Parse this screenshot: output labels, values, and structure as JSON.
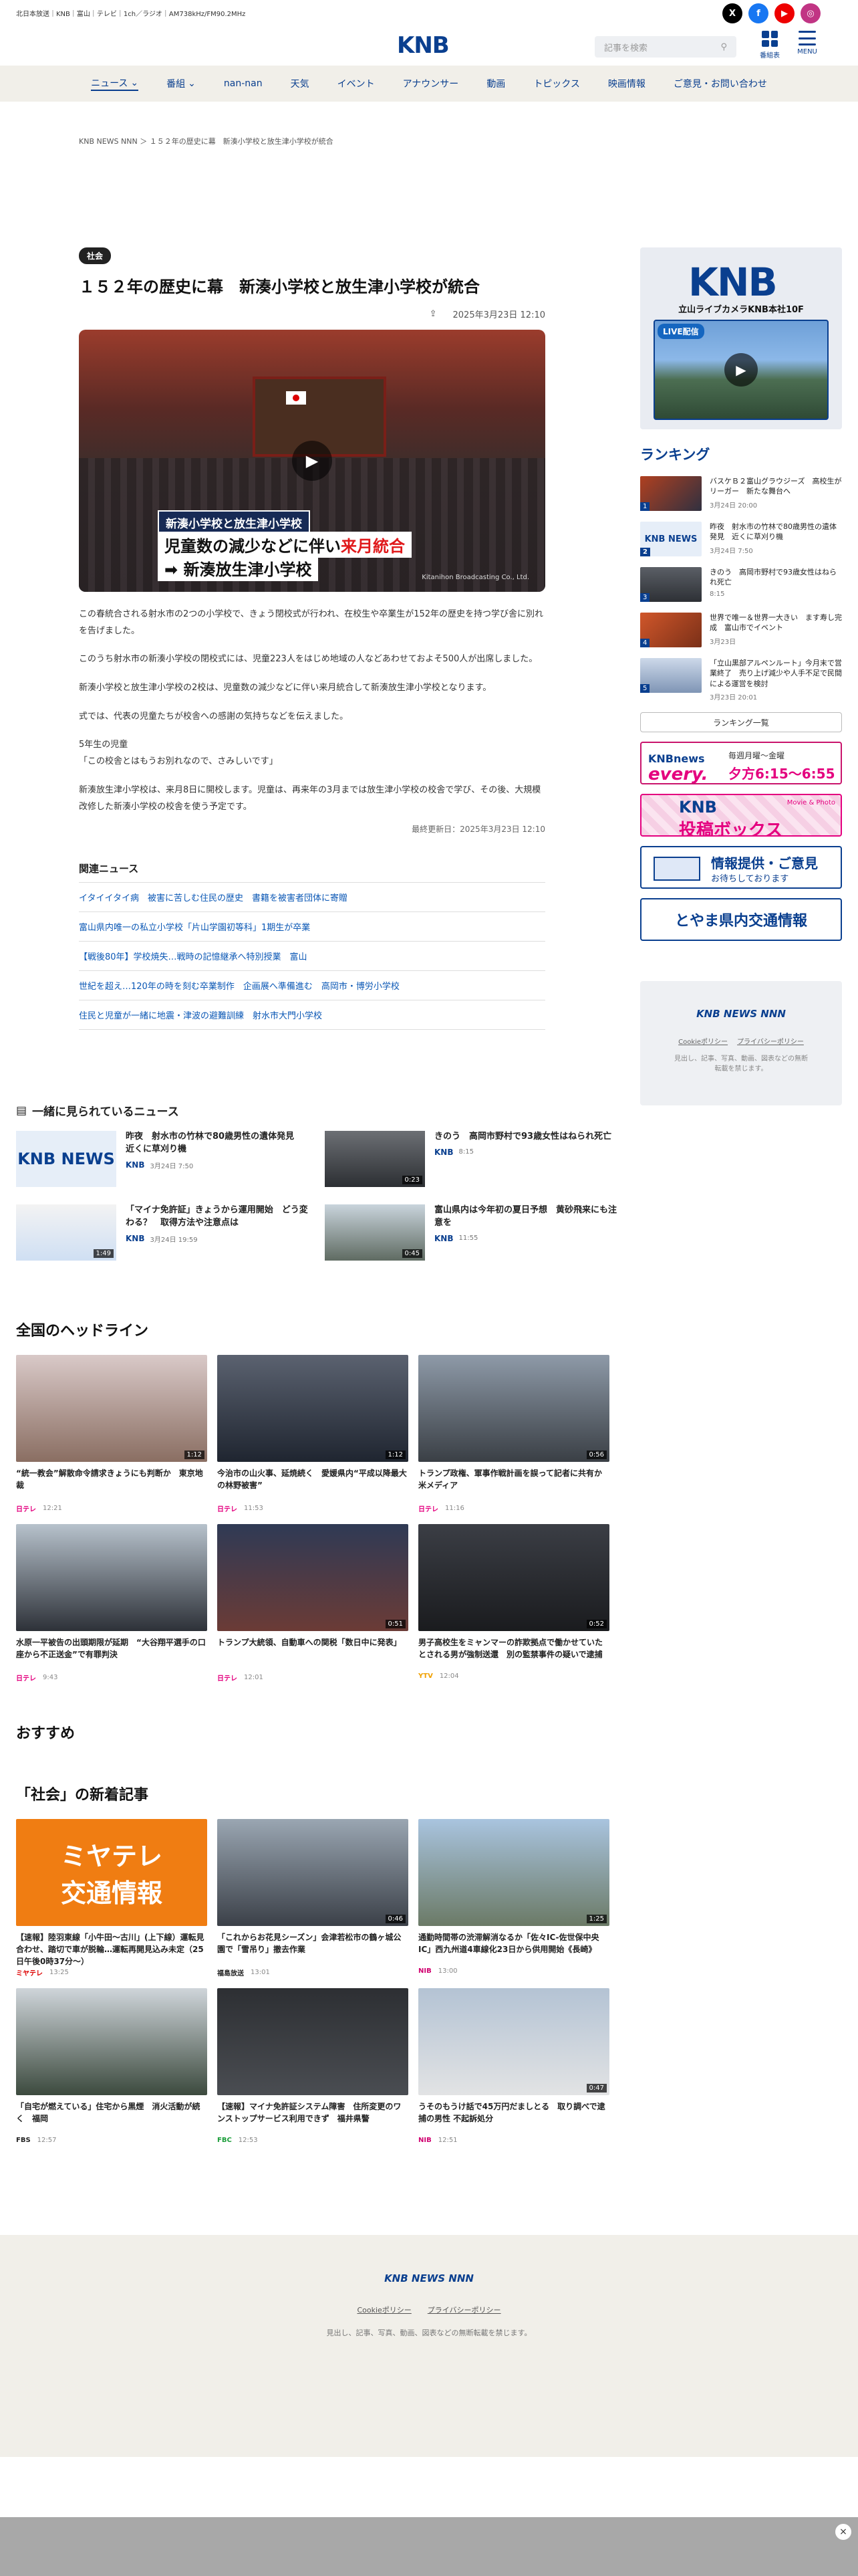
{
  "header": {
    "tagline": "北日本放送｜KNB｜富山｜テレビ｜1ch／ラジオ｜AM738kHz/FM90.2MHz",
    "logo": "KNB",
    "search_placeholder": "記事を検索",
    "tv_label": "番組表",
    "menu_label": "MENU",
    "social": [
      "X",
      "f",
      "▶",
      "◎"
    ]
  },
  "nav": {
    "items": [
      "ニュース",
      "番組",
      "nan-nan",
      "天気",
      "イベント",
      "アナウンサー",
      "動画",
      "トピックス",
      "映画情報",
      "ご意見・お問い合わせ"
    ],
    "chevron": "⌄"
  },
  "breadcrumb": "KNB NEWS NNN ＞ １５２年の歴史に幕　新湊小学校と放生津小学校が統合",
  "article": {
    "category": "社会",
    "title": "１５２年の歴史に幕　新湊小学校と放生津小学校が統合",
    "date": "2025年3月23日 12:10",
    "hero": {
      "caption1": "新湊小学校と放生津小学校",
      "caption2_a": "児童数の減少などに伴い",
      "caption2_b": "来月統合",
      "caption3": "➡ 新湊放生津小学校",
      "credit": "Kitanihon Broadcasting Co., Ltd."
    },
    "paragraphs": [
      "この春統合される射水市の2つの小学校で、きょう閉校式が行われ、在校生や卒業生が152年の歴史を持つ学び舎に別れを告げました。",
      "このうち射水市の新湊小学校の閉校式には、児童223人をはじめ地域の人などあわせておよそ500人が出席しました。",
      "新湊小学校と放生津小学校の2校は、児童数の減少などに伴い来月統合して新湊放生津小学校となります。",
      "式では、代表の児童たちが校舎への感謝の気持ちなどを伝えました。",
      "5年生の児童\n「この校舎とはもうお別れなので、さみしいです」",
      "新湊放生津小学校は、来月8日に開校します。児童は、再来年の3月までは放生津小学校の校舎で学び、その後、大規模改修した新湊小学校の校舎を使う予定です。"
    ],
    "updated": "最終更新日：2025年3月23日 12:10",
    "related_title": "関連ニュース",
    "related": [
      "イタイイタイ病　被害に苦しむ住民の歴史　書籍を被害者団体に寄贈",
      "富山県内唯一の私立小学校「片山学園初等科」1期生が卒業",
      "【戦後80年】学校焼失…戦時の記憶継承へ特別授業　富山",
      "世紀を超え…120年の時を刻む卒業制作　企画展へ準備進む　高岡市・博労小学校",
      "住民と児童が一緒に地震・津波の避難訓練　射水市大門小学校"
    ]
  },
  "sidebar": {
    "cam_logo": "KNB",
    "cam_title": "立山ライブカメラKNB本社10F",
    "live_label": "LIVE配信",
    "ranking_title": "ランキング",
    "ranking": [
      {
        "num": "1",
        "title": "バスケＢ２富山グラウジーズ　高校生がリーガー　新たな舞台へ",
        "date": "3月24日 20:00"
      },
      {
        "num": "2",
        "title": "昨夜　射水市の竹林で80歳男性の遺体発見　近くに草刈り機",
        "date": "3月24日 7:50"
      },
      {
        "num": "3",
        "title": "きのう　高岡市野村で93歳女性はねられ死亡",
        "date": "8:15"
      },
      {
        "num": "4",
        "title": "世界で唯一＆世界一大きい　ます寿し完成　富山市でイベント",
        "date": "3月23日"
      },
      {
        "num": "5",
        "title": "「立山黒部アルペンルート」今月末で営業終了　売り上げ減少や人手不足で民間による運営を検討",
        "date": "3月23日 20:01"
      }
    ],
    "ranking_button": "ランキング一覧",
    "banner_every_1": "KNBnews",
    "banner_every_2": "every.",
    "banner_every_time_label": "毎週月曜〜金曜",
    "banner_every_time": "夕方6:15〜6:55",
    "banner_toko_1": "KNB",
    "banner_toko_2": "投稿ボックス",
    "banner_toko_3": "Movie & Photo",
    "banner_info_1": "情報提供・ご意見",
    "banner_info_2": "お待ちしております",
    "banner_traffic": "とやま県内交通情報",
    "foot_logo": "KNB NEWS NNN",
    "foot_links": [
      "Cookieポリシー",
      "プライバシーポリシー"
    ],
    "foot_note": "見出し、記事、写真、動画、図表などの無断転載を禁じます。"
  },
  "watched": {
    "title": "一緒に見られているニュース",
    "items": [
      {
        "title": "昨夜　射水市の竹林で80歳男性の遺体発見　近くに草刈り機",
        "src": "KNB",
        "time": "3月24日 7:50",
        "dur": ""
      },
      {
        "title": "きのう　高岡市野村で93歳女性はねられ死亡",
        "src": "KNB",
        "time": "8:15",
        "dur": "0:23"
      },
      {
        "title": "「マイナ免許証」きょうから運用開始　どう変わる？　取得方法や注意点は",
        "src": "KNB",
        "time": "3月24日 19:59",
        "dur": "1:49"
      },
      {
        "title": "富山県内は今年初の夏日予想　黄砂飛来にも注意を",
        "src": "KNB",
        "time": "11:55",
        "dur": "0:45"
      }
    ]
  },
  "headlines": {
    "title": "全国のヘッドライン",
    "items": [
      {
        "title": "“統一教会”解散命令請求きょうにも判断か　東京地裁",
        "src": "日テレ",
        "time": "12:21",
        "dur": "1:12",
        "cls": "ntv"
      },
      {
        "title": "今治市の山火事、延焼続く　愛媛県内“平成以降最大の林野被害”",
        "src": "日テレ",
        "time": "11:53",
        "dur": "1:12",
        "cls": "ntv"
      },
      {
        "title": "トランプ政権、軍事作戦計画を誤って記者に共有か　米メディア",
        "src": "日テレ",
        "time": "11:16",
        "dur": "0:56",
        "cls": "ntv"
      },
      {
        "title": "水原一平被告の出頭期限が延期　“大谷翔平選手の口座から不正送金”で有罪判決",
        "src": "日テレ",
        "time": "9:43",
        "dur": "",
        "cls": "ntv"
      },
      {
        "title": "トランプ大統領、自動車への関税「数日中に発表」",
        "src": "日テレ",
        "time": "12:01",
        "dur": "0:51",
        "cls": "ntv"
      },
      {
        "title": "男子高校生をミャンマーの詐欺拠点で働かせていたとされる男が強制送還　別の監禁事件の疑いで逮捕",
        "src": "YTV",
        "time": "12:04",
        "dur": "0:52",
        "cls": "ytv"
      }
    ]
  },
  "recommended_title": "おすすめ",
  "social_news": {
    "title": "「社会」の新着記事",
    "items": [
      {
        "title": "【速報】陸羽東線「小牛田〜古川」(上下線）運転見合わせ、踏切で車が脱輪…運転再開見込み未定（25日午後0時37分〜）",
        "src": "ミヤテレ",
        "time": "13:25",
        "dur": "",
        "cls": "mtv"
      },
      {
        "title": "「これからお花見シーズン」会津若松市の鶴ヶ城公園で「雪吊り」撤去作業",
        "src": "福島放送",
        "time": "13:01",
        "dur": "0:46",
        "cls": "fbs"
      },
      {
        "title": "通勤時間帯の渋滞解消なるか「佐々IC-佐世保中央IC」西九州道4車線化23日から供用開始《長崎》",
        "src": "NIB",
        "time": "13:00",
        "dur": "1:25",
        "cls": "nib"
      },
      {
        "title": "「自宅が燃えている」住宅から黒煙　消火活動が続く　福岡",
        "src": "FBS",
        "time": "12:57",
        "dur": "",
        "cls": "fbs"
      },
      {
        "title": "【速報】マイナ免許証システム障害　住所変更のワンストップサービス利用できず　福井県警",
        "src": "FBC",
        "time": "12:53",
        "dur": "",
        "cls": "fbc"
      },
      {
        "title": "うそのもうけ話で45万円だましとる　取り調べで逮捕の男性 不起訴処分",
        "src": "NIB",
        "time": "12:51",
        "dur": "0:47",
        "cls": "nib"
      }
    ]
  },
  "footer": {
    "logo": "KNB NEWS NNN",
    "links": [
      "Cookieポリシー",
      "プライバシーポリシー"
    ],
    "copy": "見出し、記事、写真、動画、図表などの無断転載を禁じます。"
  },
  "ad_close": "×"
}
